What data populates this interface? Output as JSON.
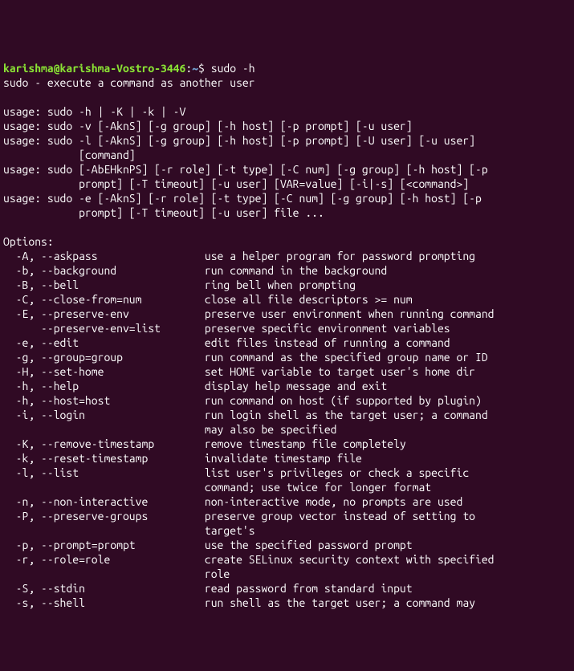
{
  "prompt": {
    "user": "karishma@karishma-Vostro-3446",
    "colon": ":",
    "path": "~",
    "dollar": "$ ",
    "command": "sudo -h"
  },
  "summary": "sudo - execute a command as another user",
  "blank": "",
  "usage": {
    "l1": "usage: sudo -h | -K | -k | -V",
    "l2": "usage: sudo -v [-AknS] [-g group] [-h host] [-p prompt] [-u user]",
    "l3": "usage: sudo -l [-AknS] [-g group] [-h host] [-p prompt] [-U user] [-u user]",
    "l3b": "            [command]",
    "l4": "usage: sudo [-AbEHknPS] [-r role] [-t type] [-C num] [-g group] [-h host] [-p",
    "l4b": "            prompt] [-T timeout] [-u user] [VAR=value] [-i|-s] [<command>]",
    "l5": "usage: sudo -e [-AknS] [-r role] [-t type] [-C num] [-g group] [-h host] [-p",
    "l5b": "            prompt] [-T timeout] [-u user] file ..."
  },
  "optheader": "Options:",
  "opts": {
    "o01": "  -A, --askpass                 use a helper program for password prompting",
    "o02": "  -b, --background              run command in the background",
    "o03": "  -B, --bell                    ring bell when prompting",
    "o04": "  -C, --close-from=num          close all file descriptors >= num",
    "o05": "  -E, --preserve-env            preserve user environment when running command",
    "o06": "      --preserve-env=list       preserve specific environment variables",
    "o07": "  -e, --edit                    edit files instead of running a command",
    "o08": "  -g, --group=group             run command as the specified group name or ID",
    "o09": "  -H, --set-home                set HOME variable to target user's home dir",
    "o10": "  -h, --help                    display help message and exit",
    "o11": "  -h, --host=host               run command on host (if supported by plugin)",
    "o12": "  -i, --login                   run login shell as the target user; a command",
    "o12b": "                                may also be specified",
    "o13": "  -K, --remove-timestamp        remove timestamp file completely",
    "o14": "  -k, --reset-timestamp         invalidate timestamp file",
    "o15": "  -l, --list                    list user's privileges or check a specific",
    "o15b": "                                command; use twice for longer format",
    "o16": "  -n, --non-interactive         non-interactive mode, no prompts are used",
    "o17": "  -P, --preserve-groups         preserve group vector instead of setting to",
    "o17b": "                                target's",
    "o18": "  -p, --prompt=prompt           use the specified password prompt",
    "o19": "  -r, --role=role               create SELinux security context with specified",
    "o19b": "                                role",
    "o20": "  -S, --stdin                   read password from standard input",
    "o21": "  -s, --shell                   run shell as the target user; a command may"
  }
}
